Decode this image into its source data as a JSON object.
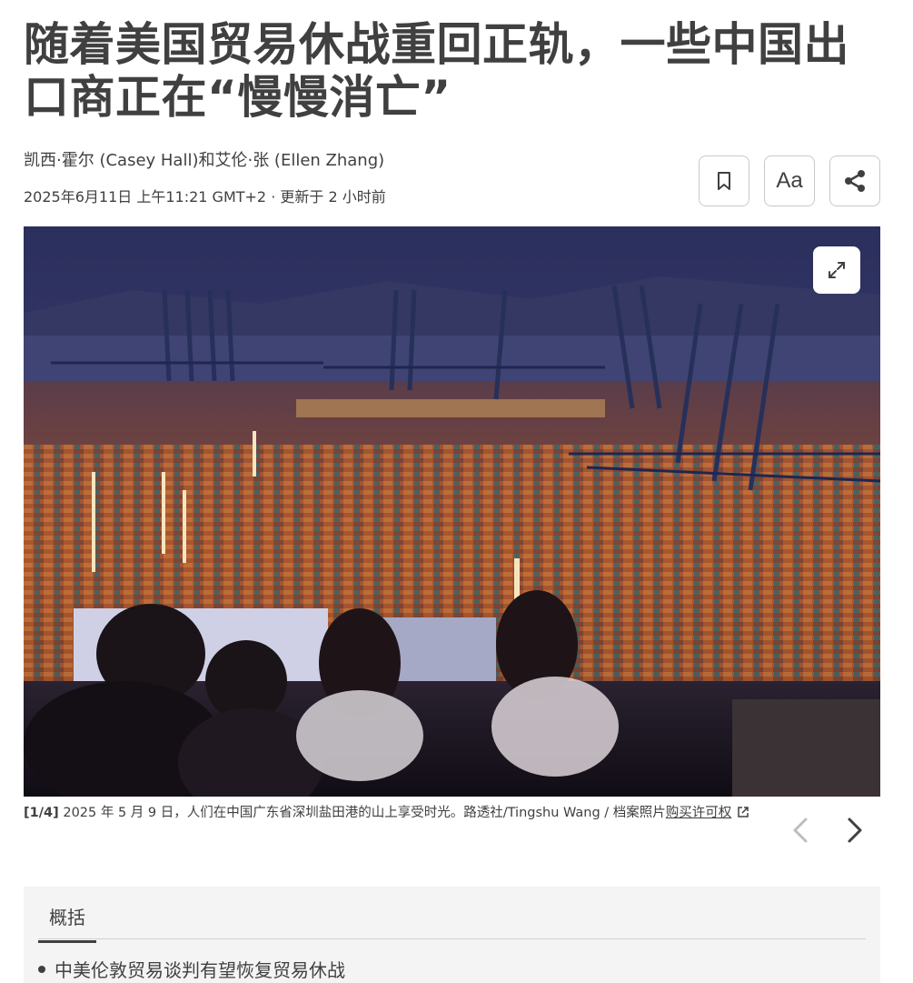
{
  "article": {
    "headline": "随着美国贸易休战重回正轨，一些中国出口商正在“慢慢消亡”",
    "byline": "凯西·霍尔 (Casey Hall)和艾伦·张 (Ellen Zhang)",
    "dateline": "2025年6月11日 上午11:21 GMT+2 · 更新于 2 小时前"
  },
  "actions": {
    "bookmark_icon": "bookmark-icon",
    "text_size_label": "Aa",
    "share_icon": "share-icon"
  },
  "photo": {
    "expand_icon": "expand-icon",
    "caption_counter": "[1/4]",
    "caption_text": " 2025 年 5 月 9 日，人们在中国广东省深圳盐田港的山上享受时光。路透社/Tingshu Wang / 档案照片",
    "license_link": "购买许可权",
    "prev_icon": "chevron-left-icon",
    "next_icon": "chevron-right-icon"
  },
  "summary": {
    "tab_label": "概括",
    "items": [
      "中美伦敦贸易谈判有望恢复贸易休战"
    ]
  },
  "colors": {
    "text": "#404040",
    "summary_bg": "#f4f4f4",
    "sky": "#2a2f5a",
    "container_orange": "#c8642a"
  }
}
